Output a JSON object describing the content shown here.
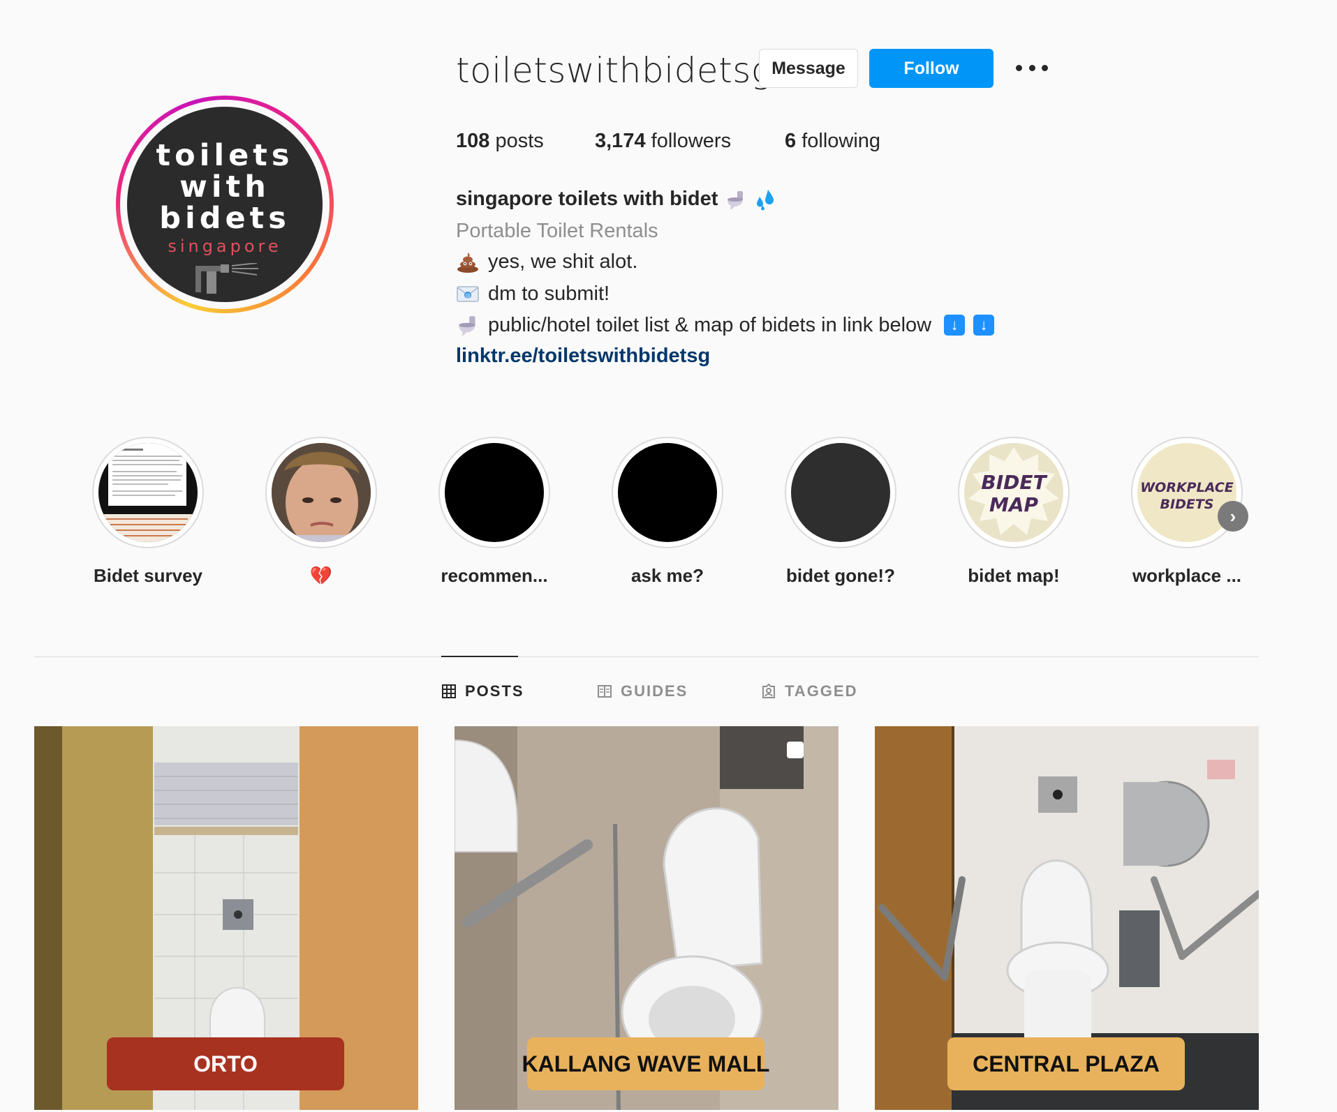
{
  "profile": {
    "username": "toiletswithbidetsg",
    "avatar": {
      "line1": "toilets",
      "line2": "with",
      "line3": "bidets",
      "subtitle": "singapore"
    },
    "message_label": "Message",
    "follow_label": "Follow",
    "more_icon": "more-options-icon"
  },
  "stats": {
    "posts_count": "108",
    "posts_label": "posts",
    "followers_count": "3,174",
    "followers_label": "followers",
    "following_count": "6",
    "following_label": "following"
  },
  "bio": {
    "name": "singapore toilets with bidet",
    "category": "Portable Toilet Rentals",
    "line1": "yes, we shit alot.",
    "line2": "dm to submit!",
    "line3": "public/hotel toilet list & map of bidets in link below",
    "link": "linktr.ee/toiletswithbidetsg"
  },
  "highlights": [
    {
      "label": "Bidet survey"
    },
    {
      "label": "💔"
    },
    {
      "label": "recommen..."
    },
    {
      "label": "ask me?"
    },
    {
      "label": "bidet gone!?"
    },
    {
      "label": "bidet map!",
      "art": [
        "BIDET",
        "MAP"
      ]
    },
    {
      "label": "workplace ...",
      "art": [
        "WORKPLACE",
        "BIDETS"
      ]
    }
  ],
  "tabs": [
    {
      "label": "POSTS",
      "icon": "grid-icon"
    },
    {
      "label": "GUIDES",
      "icon": "guides-icon"
    },
    {
      "label": "TAGGED",
      "icon": "tagged-icon"
    }
  ],
  "posts": [
    {
      "label": "ORTO",
      "label_bg": "#a83220",
      "label_color": "#ffffff"
    },
    {
      "label": "KALLANG WAVE MALL",
      "label_bg": "#e8b25c",
      "label_color": "#111111"
    },
    {
      "label": "CENTRAL PLAZA",
      "label_bg": "#e8b25c",
      "label_color": "#111111"
    }
  ],
  "colors": {
    "follow_button": "#0095f6",
    "link": "#00376b",
    "background": "#fafafa"
  }
}
